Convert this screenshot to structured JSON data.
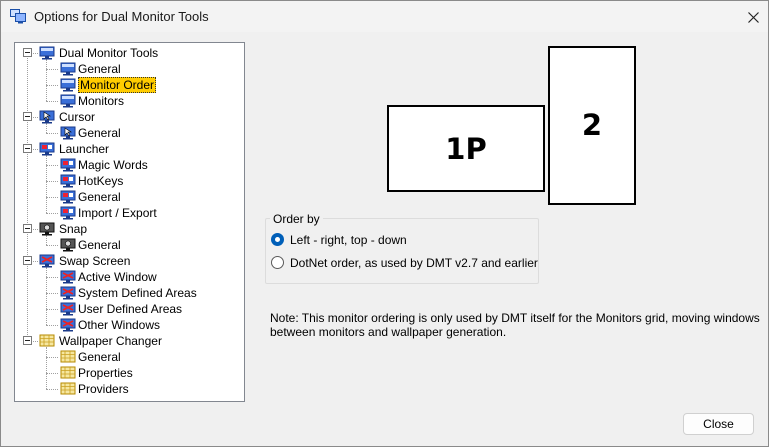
{
  "window": {
    "title": "Options for Dual Monitor Tools",
    "close_icon": "close-icon"
  },
  "tree": {
    "nodes": [
      {
        "label": "Dual Monitor Tools",
        "level": 0,
        "icon": "monitor-icon"
      },
      {
        "label": "General",
        "level": 1,
        "icon": "monitor-icon"
      },
      {
        "label": "Monitor Order",
        "level": 1,
        "icon": "monitor-icon",
        "selected": true
      },
      {
        "label": "Monitors",
        "level": 1,
        "icon": "monitor-icon"
      },
      {
        "label": "Cursor",
        "level": 0,
        "icon": "cursor-icon"
      },
      {
        "label": "General",
        "level": 1,
        "icon": "cursor-icon"
      },
      {
        "label": "Launcher",
        "level": 0,
        "icon": "launcher-icon"
      },
      {
        "label": "Magic Words",
        "level": 1,
        "icon": "launcher-icon"
      },
      {
        "label": "HotKeys",
        "level": 1,
        "icon": "launcher-icon"
      },
      {
        "label": "General",
        "level": 1,
        "icon": "launcher-icon"
      },
      {
        "label": "Import / Export",
        "level": 1,
        "icon": "launcher-icon"
      },
      {
        "label": "Snap",
        "level": 0,
        "icon": "snap-icon"
      },
      {
        "label": "General",
        "level": 1,
        "icon": "snap-icon"
      },
      {
        "label": "Swap Screen",
        "level": 0,
        "icon": "swap-screen-icon"
      },
      {
        "label": "Active Window",
        "level": 1,
        "icon": "swap-screen-icon"
      },
      {
        "label": "System Defined Areas",
        "level": 1,
        "icon": "swap-screen-icon"
      },
      {
        "label": "User Defined Areas",
        "level": 1,
        "icon": "swap-screen-icon"
      },
      {
        "label": "Other Windows",
        "level": 1,
        "icon": "swap-screen-icon"
      },
      {
        "label": "Wallpaper Changer",
        "level": 0,
        "icon": "wallpaper-icon"
      },
      {
        "label": "General",
        "level": 1,
        "icon": "wallpaper-icon"
      },
      {
        "label": "Properties",
        "level": 1,
        "icon": "wallpaper-icon"
      },
      {
        "label": "Providers",
        "level": 1,
        "icon": "wallpaper-icon"
      }
    ]
  },
  "monitors": [
    {
      "label": "1P"
    },
    {
      "label": "2"
    }
  ],
  "order_by": {
    "title": "Order by",
    "options": [
      {
        "label": "Left - right, top - down",
        "checked": true
      },
      {
        "label": "DotNet order, as used by DMT v2.7 and earlier",
        "checked": false
      }
    ]
  },
  "note": "Note: This monitor ordering is only used by DMT itself for the Monitors grid, moving windows between monitors and wallpaper generation.",
  "buttons": {
    "close": "Close"
  },
  "colors": {
    "selection": "#ffcc00",
    "radio_accent": "#005fb8"
  }
}
